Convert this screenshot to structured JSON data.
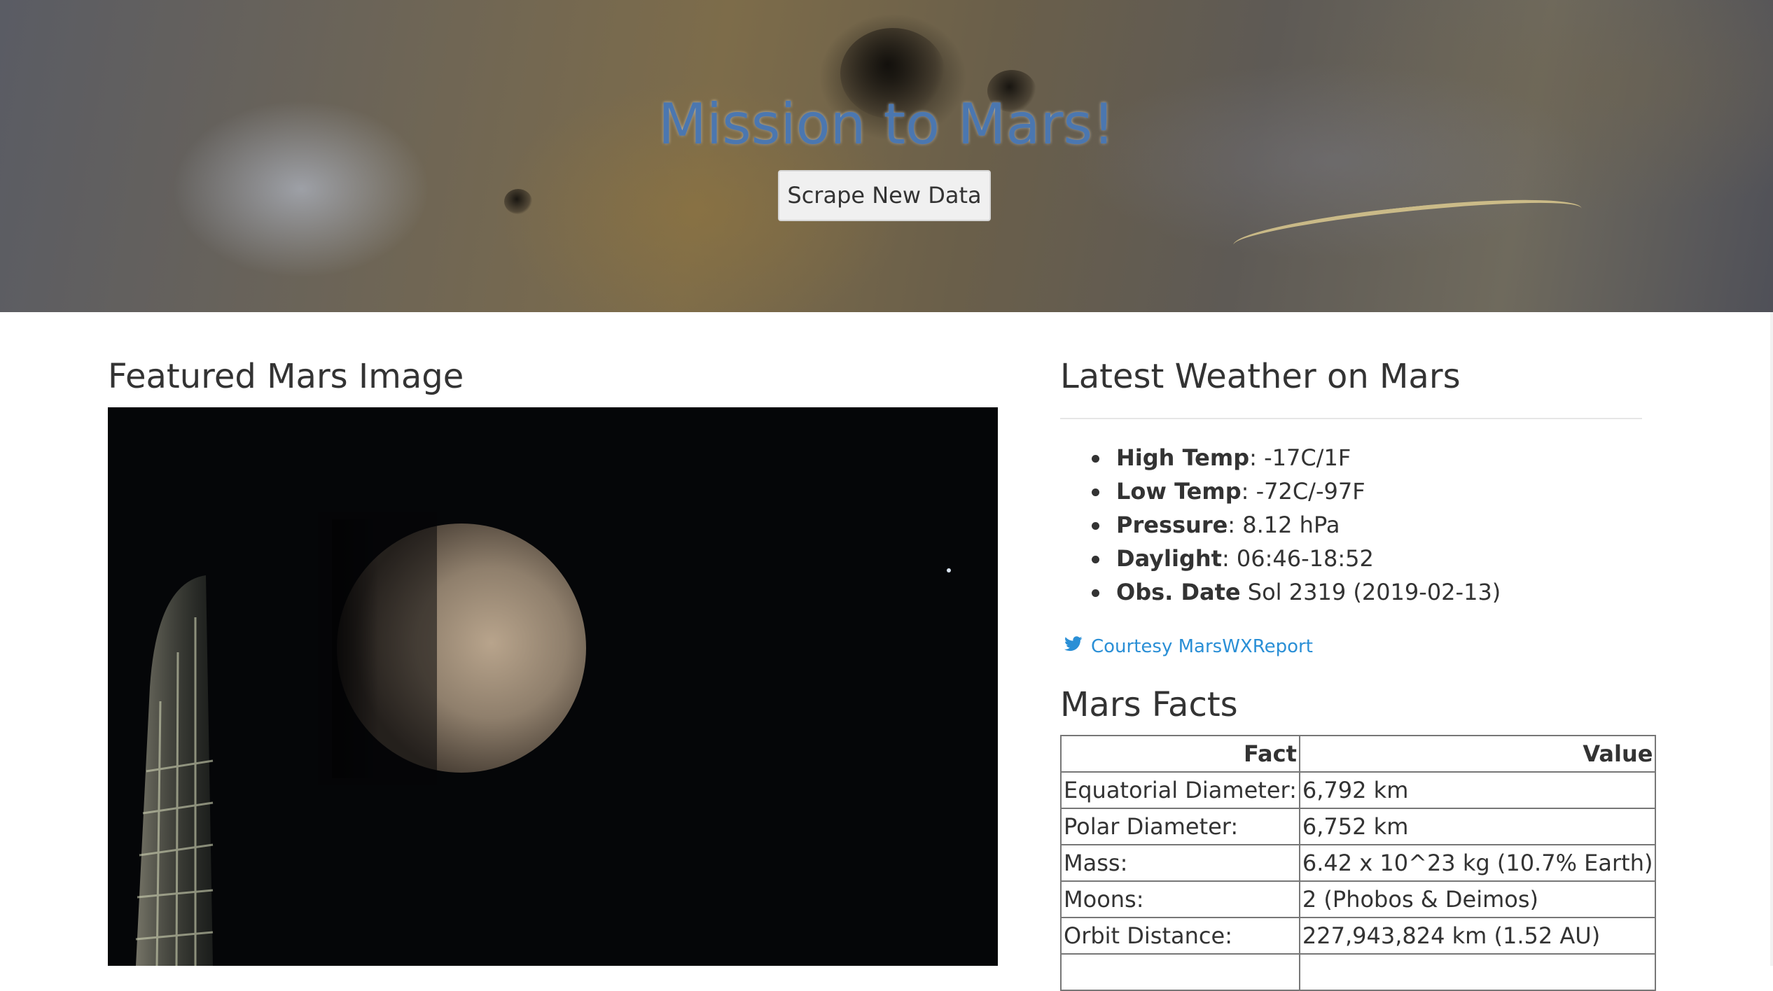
{
  "hero": {
    "title": "Mission to Mars!",
    "scrape_button_label": "Scrape New Data"
  },
  "featured": {
    "heading": "Featured Mars Image"
  },
  "weather": {
    "heading": "Latest Weather on Mars",
    "items": [
      {
        "label": "High Temp",
        "value": ": -17C/1F"
      },
      {
        "label": "Low Temp",
        "value": ": -72C/-97F"
      },
      {
        "label": "Pressure",
        "value": ": 8.12 hPa"
      },
      {
        "label": "Daylight",
        "value": ": 06:46-18:52"
      },
      {
        "label": "Obs. Date",
        "value": " Sol 2319 (2019-02-13)"
      }
    ],
    "courtesy_link": "Courtesy MarsWXReport"
  },
  "facts": {
    "heading": "Mars Facts",
    "columns": [
      "Fact",
      "Value"
    ],
    "rows": [
      [
        "Equatorial Diameter:",
        "6,792 km"
      ],
      [
        "Polar Diameter:",
        "6,752 km"
      ],
      [
        "Mass:",
        "6.42 x 10^23 kg (10.7% Earth)"
      ],
      [
        "Moons:",
        "2 (Phobos & Deimos)"
      ],
      [
        "Orbit Distance:",
        "227,943,824 km (1.52 AU)"
      ]
    ]
  },
  "colors": {
    "title": "#4b77b0",
    "link": "#2a8fd6",
    "text": "#333333"
  },
  "icons": {
    "courtesy": "twitter-bird-icon"
  }
}
